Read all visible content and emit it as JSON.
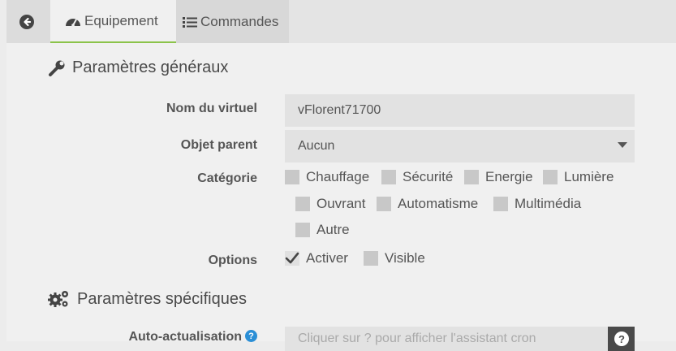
{
  "tabs": {
    "equipement": "Equipement",
    "commandes": "Commandes"
  },
  "section_general": "Paramètres généraux",
  "fields": {
    "nom_label": "Nom du virtuel",
    "nom_value": "vFlorent71700",
    "parent_label": "Objet parent",
    "parent_value": "Aucun",
    "categorie_label": "Catégorie",
    "options_label": "Options"
  },
  "categories": [
    "Chauffage",
    "Sécurité",
    "Energie",
    "Lumière",
    "Ouvrant",
    "Automatisme",
    "Multimédia",
    "Autre"
  ],
  "options": [
    {
      "label": "Activer",
      "checked": true
    },
    {
      "label": "Visible",
      "checked": false
    }
  ],
  "section_specific": "Paramètres spécifiques",
  "auto_actualisation": {
    "label": "Auto-actualisation",
    "placeholder": "Cliquer sur ? pour afficher l'assistant cron"
  },
  "colors": {
    "accent": "#8bc34a",
    "help": "#2b8fd6"
  }
}
